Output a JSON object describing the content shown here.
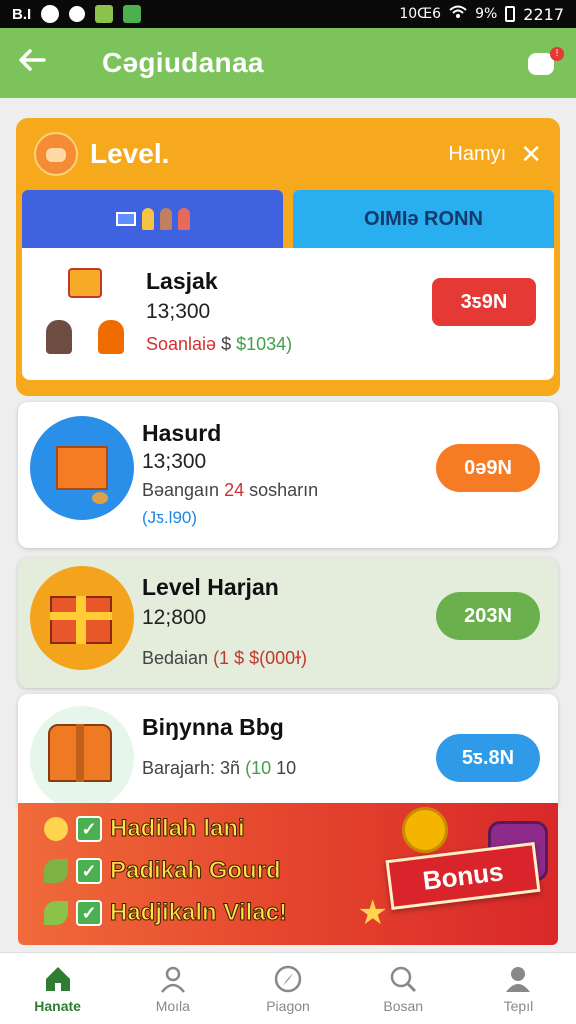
{
  "status_bar": {
    "left_text": "B.I",
    "time": "2217",
    "battery": "9%",
    "signal_text": "10Œ6"
  },
  "appbar": {
    "title": "Cəgiudanaa",
    "back_icon": "arrow-left-icon",
    "chat_icon": "chat-icon",
    "badge": "!"
  },
  "level_card": {
    "title": "Level.",
    "right_label": "Hamyı",
    "tabs": [
      {
        "label": ""
      },
      {
        "label": "OIMIə RONN"
      }
    ],
    "item": {
      "title": "Lasjak",
      "points": "13;300",
      "desc_red": "Soanlaiə",
      "desc_mid": " $ ",
      "desc_green": "$1034)",
      "button": "3ƽ9N",
      "button_color": "#e53935"
    }
  },
  "rows": [
    {
      "title": "Hasurd",
      "points": "13;300",
      "desc_a": "Bəangaın ",
      "desc_b": "24",
      "desc_c": " sosharın",
      "sub": "(Jƽ.l90)",
      "button": "0ǝ9N",
      "button_color": "#f57c24",
      "icon": "gift-box-icon"
    },
    {
      "title": "Level Harjan",
      "points": "12;800",
      "desc_a": "Bedaian ",
      "desc_b": "(1 $ $(000ɫ)",
      "button": "203N",
      "button_color": "#6ab04c",
      "icon": "present-icon"
    },
    {
      "title": "Biŋynnа Bbg",
      "points": "",
      "desc_a": "Barajarh: ",
      "desc_b": "3ñ",
      "desc_c": " (10",
      "desc_d": " 10",
      "button": "5ƽ.8N",
      "button_color": "#2f9be8",
      "icon": "treasure-chest-icon"
    }
  ],
  "banner": {
    "lines": [
      "Hadilah lani",
      "Padikah Gourd",
      "Hadjikaln Vilac!"
    ],
    "ribbon": "Bonus"
  },
  "bottom_nav": [
    {
      "label": "Hanate",
      "icon": "home-icon",
      "active": true
    },
    {
      "label": "Moıla",
      "icon": "user-icon",
      "active": false
    },
    {
      "label": "Piagon",
      "icon": "compass-icon",
      "active": false
    },
    {
      "label": "Bosan",
      "icon": "search-icon",
      "active": false
    },
    {
      "label": "Tepıl",
      "icon": "profile-icon",
      "active": false
    }
  ]
}
